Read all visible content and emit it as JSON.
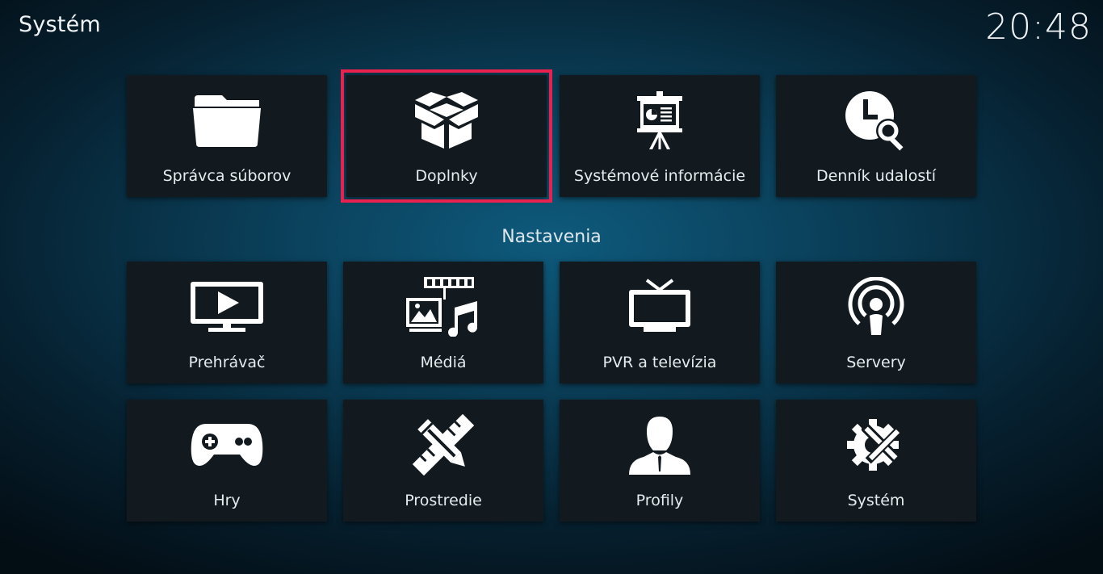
{
  "header": {
    "title": "Systém",
    "clock": "20:48"
  },
  "top_row": [
    {
      "label": "Správca súborov",
      "icon": "folder-icon"
    },
    {
      "label": "Doplnky",
      "icon": "box-icon",
      "focused": true
    },
    {
      "label": "Systémové informácie",
      "icon": "presentation-board-icon"
    },
    {
      "label": "Denník udalostí",
      "icon": "clock-search-icon"
    }
  ],
  "section": {
    "title": "Nastavenia"
  },
  "settings_rows": [
    [
      {
        "label": "Prehrávač",
        "icon": "monitor-play-icon"
      },
      {
        "label": "Médiá",
        "icon": "media-icon"
      },
      {
        "label": "PVR a televízia",
        "icon": "tv-antenna-icon"
      },
      {
        "label": "Servery",
        "icon": "broadcast-icon"
      }
    ],
    [
      {
        "label": "Hry",
        "icon": "gamepad-icon"
      },
      {
        "label": "Prostredie",
        "icon": "pencil-ruler-icon"
      },
      {
        "label": "Profily",
        "icon": "user-profile-icon"
      },
      {
        "label": "Systém",
        "icon": "gear-wrench-icon"
      }
    ]
  ],
  "colors": {
    "focus_outline": "#e8214e",
    "tile_bg": "#121a20"
  }
}
